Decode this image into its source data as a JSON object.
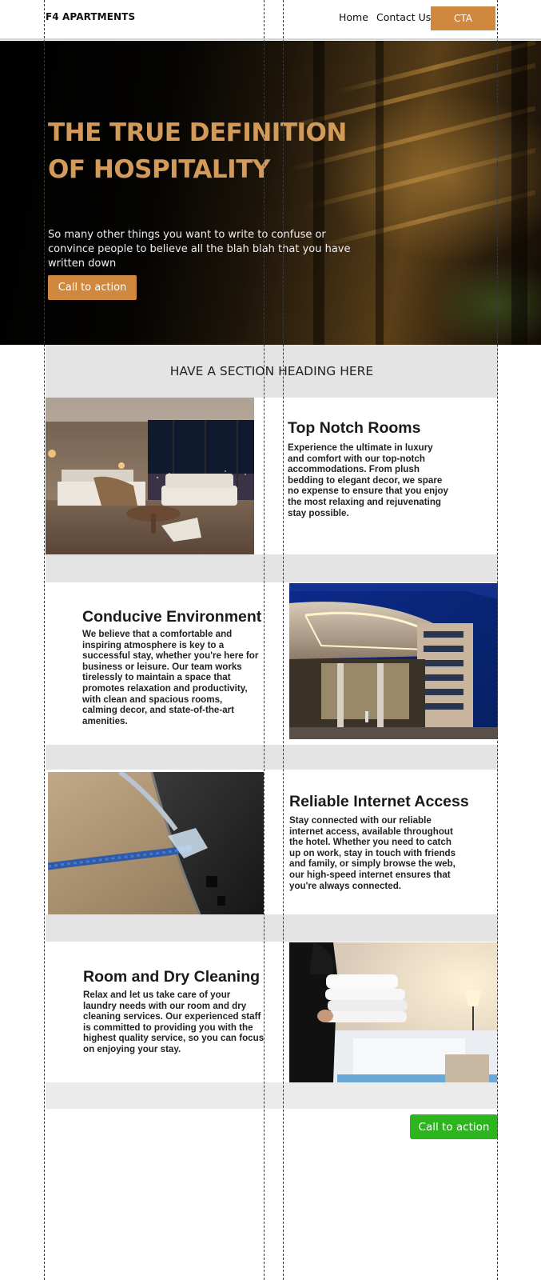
{
  "header": {
    "logo": "F4 APARTMENTS",
    "nav": [
      {
        "label": "Home"
      },
      {
        "label": "Contact Us"
      }
    ],
    "cta_label": "CTA"
  },
  "hero": {
    "title": "THE TRUE DEFINITION OF HOSPITALITY",
    "subtitle": "So many other things you want to write to confuse or convince people to believe all the blah blah that you have written down",
    "button_label": "Call to action"
  },
  "section": {
    "heading": "HAVE A SECTION HEADING HERE"
  },
  "features": [
    {
      "title": "Top Notch Rooms",
      "text": "Experience the ultimate in luxury and comfort with our top-notch accommodations. From plush bedding to elegant decor, we spare no expense to ensure that you enjoy the most relaxing and rejuvenating stay possible.",
      "image": "hotel-room-photo"
    },
    {
      "title": "Conducive Environment",
      "text": "We believe that a comfortable and inspiring atmosphere is key to a successful stay, whether you're here for business or leisure. Our team works tirelessly to maintain a space that promotes relaxation and productivity, with clean and spacious rooms, calming decor, and state-of-the-art amenities.",
      "image": "hotel-exterior-photo"
    },
    {
      "title": "Reliable Internet Access",
      "text": "Stay connected with our reliable internet access, available throughout the hotel. Whether you need to catch up on work, stay in touch with friends and family, or simply browse the web, our high-speed internet ensures that you're always connected.",
      "image": "ethernet-cable-photo"
    },
    {
      "title": "Room and Dry Cleaning",
      "text": "Relax and let us take care of your laundry needs with our room and dry cleaning services. Our experienced staff is committed to providing you with the highest quality service, so you can focus on enjoying your stay.",
      "image": "towels-photo"
    }
  ],
  "footer_cta": {
    "label": "Call to action"
  },
  "colors": {
    "accent_orange": "#d0883f",
    "hero_title": "#d39a5a",
    "green_button": "#2db51d",
    "band_grey": "#e4e4e4"
  }
}
